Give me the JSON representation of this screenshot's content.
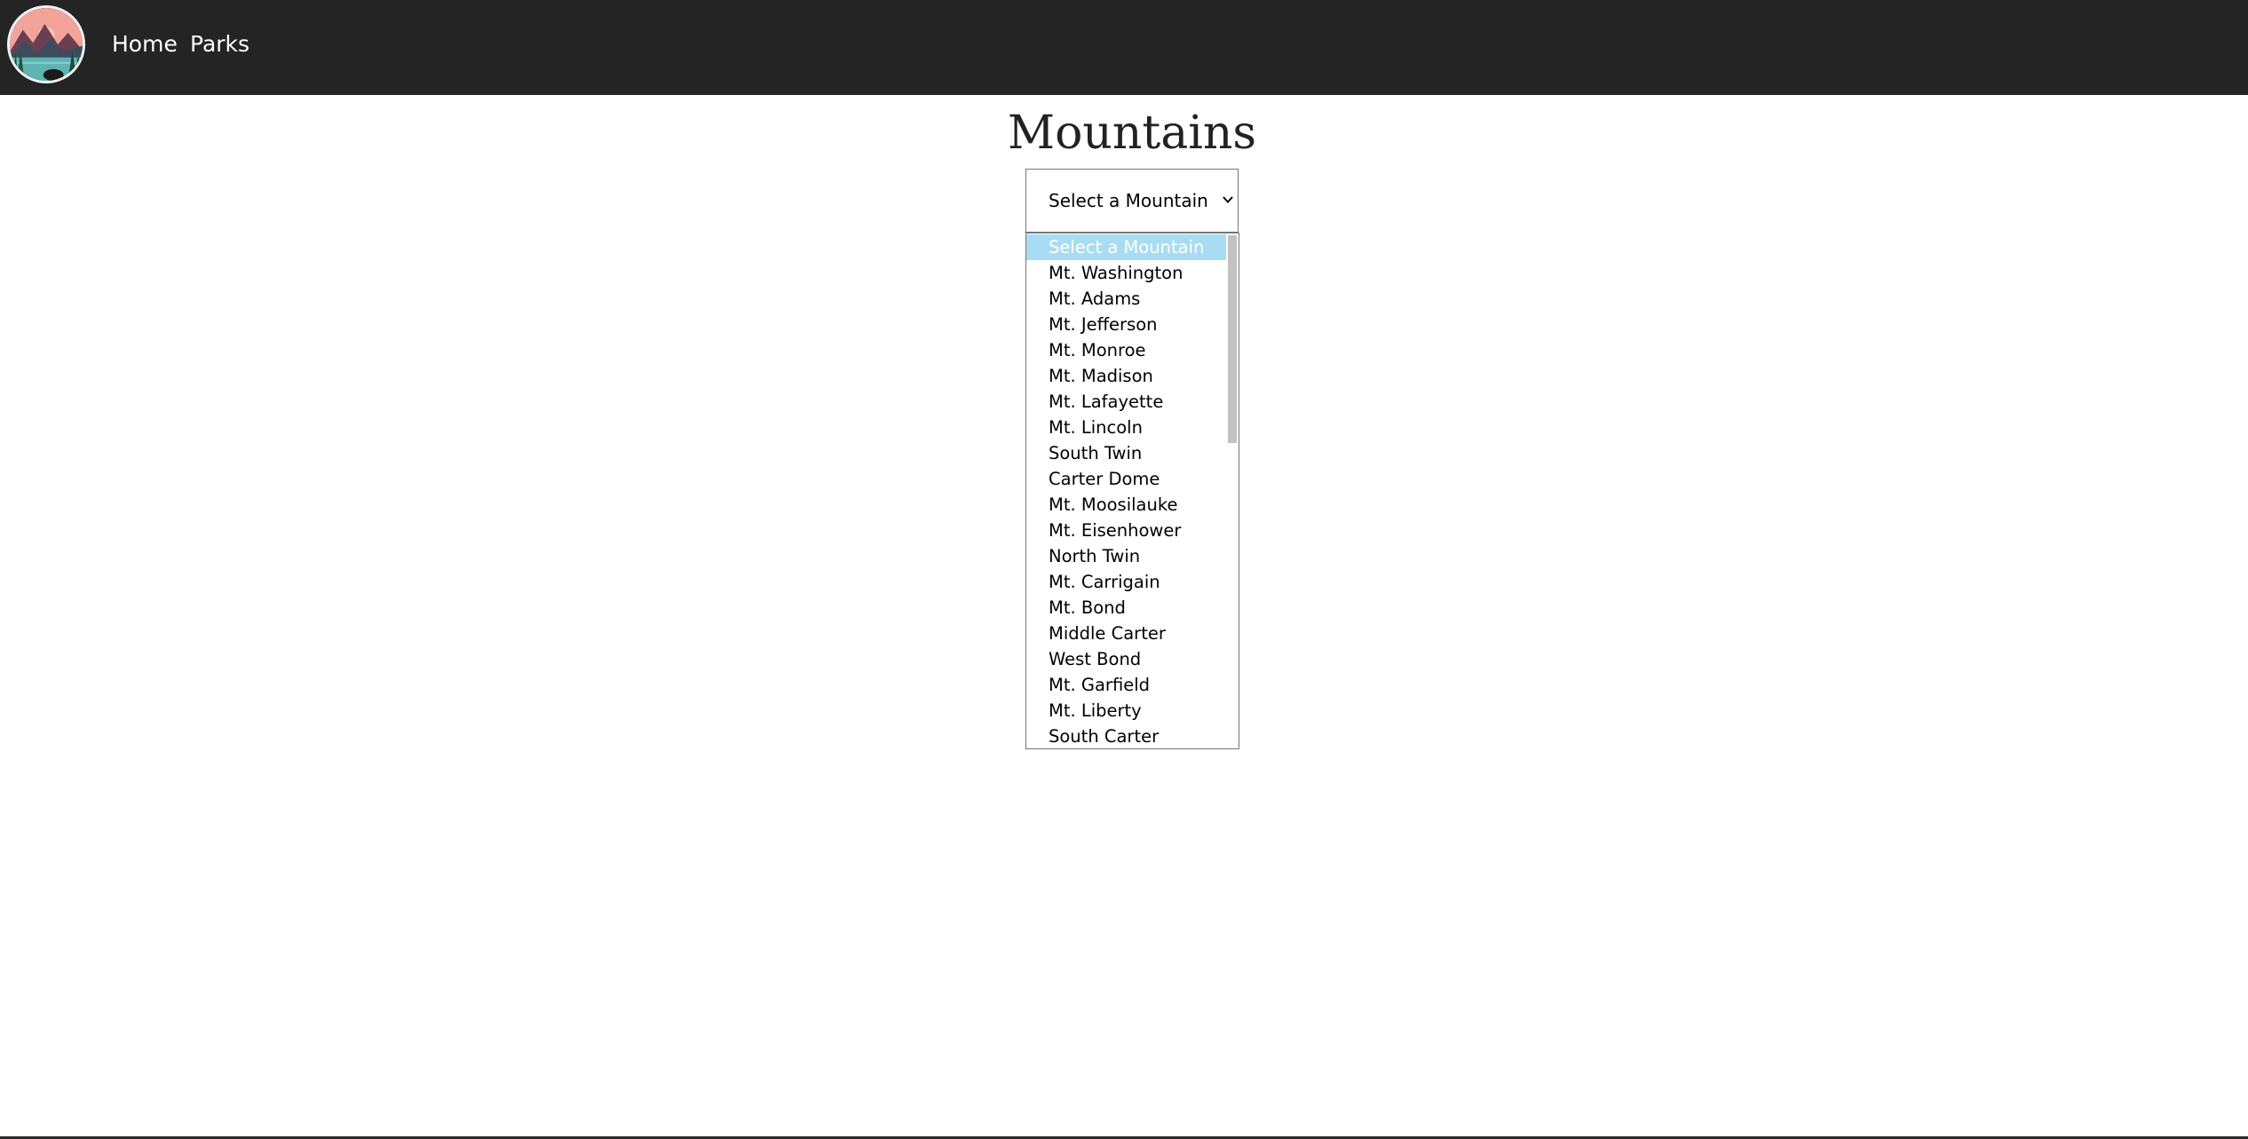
{
  "nav": {
    "links": [
      {
        "label": "Home"
      },
      {
        "label": "Parks"
      }
    ]
  },
  "page": {
    "title": "Mountains"
  },
  "mountain_select": {
    "selected_label": "Select a Mountain",
    "options": [
      "Select a Mountain",
      "Mt. Washington",
      "Mt. Adams",
      "Mt. Jefferson",
      "Mt. Monroe",
      "Mt. Madison",
      "Mt. Lafayette",
      "Mt. Lincoln",
      "South Twin",
      "Carter Dome",
      "Mt. Moosilauke",
      "Mt. Eisenhower",
      "North Twin",
      "Mt. Carrigain",
      "Mt. Bond",
      "Middle Carter",
      "West Bond",
      "Mt. Garfield",
      "Mt. Liberty",
      "South Carter"
    ],
    "highlighted_index": 0
  },
  "colors": {
    "navbar_bg": "#242424",
    "highlight_bg": "#a8dcf3",
    "logo_sky": "#f2a49a",
    "logo_water": "#5fb3b3"
  },
  "icons": {
    "logo": "mountain-lake-logo",
    "dropdown": "chevron-down-icon"
  }
}
